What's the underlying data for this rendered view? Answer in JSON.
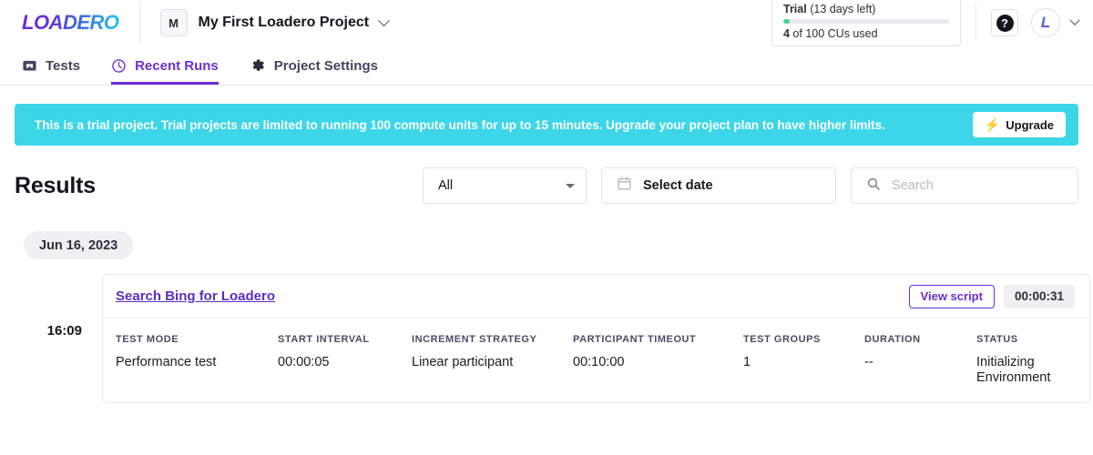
{
  "topbar": {
    "logo_text": "LOADERO",
    "project_initial": "M",
    "project_name": "My First Loadero Project",
    "project_chevron_icon": "chevron-down-icon",
    "trial": {
      "label": "Trial",
      "days_left": "(13 days left)",
      "usage_used": "4",
      "usage_rest": " of 100 CUs used",
      "progress_percent": 4,
      "progress_color": "#3DD68C"
    },
    "help_icon": "question-mark-icon",
    "avatar_letter": "L",
    "avatar_chevron_icon": "chevron-down-icon"
  },
  "tabs": [
    {
      "label": "Tests",
      "icon": "monitor-icon",
      "active": false
    },
    {
      "label": "Recent Runs",
      "icon": "clock-icon",
      "active": true
    },
    {
      "label": "Project Settings",
      "icon": "gear-icon",
      "active": false
    }
  ],
  "banner": {
    "message": "This is a trial project. Trial projects are limited to running 100 compute units for up to 15 minutes. Upgrade your project plan to have higher limits.",
    "button_label": "Upgrade",
    "button_icon": "bolt-icon",
    "background_color": "#3DD6E8"
  },
  "results": {
    "title": "Results",
    "filter_selected": "All",
    "filter_caret_icon": "caret-down-icon",
    "date_label": "Select date",
    "date_icon": "calendar-icon",
    "search_placeholder": "Search",
    "search_value": "",
    "search_icon": "search-icon"
  },
  "run_group": {
    "date_chip": "Jun 16, 2023",
    "run": {
      "time": "16:09",
      "title": "Search Bing for Loadero",
      "view_script_label": "View script",
      "duration_chip": "00:00:31",
      "columns": [
        {
          "header": "TEST MODE",
          "value": "Performance test"
        },
        {
          "header": "START INTERVAL",
          "value": "00:00:05"
        },
        {
          "header": "INCREMENT STRATEGY",
          "value": "Linear participant"
        },
        {
          "header": "PARTICIPANT TIMEOUT",
          "value": "00:10:00"
        },
        {
          "header": "TEST GROUPS",
          "value": "1"
        },
        {
          "header": "DURATION",
          "value": "--"
        },
        {
          "header": "STATUS",
          "value": "Initializing Environment"
        }
      ]
    }
  },
  "theme": {
    "accent_purple": "#6B2FD6",
    "banner_cyan": "#3DD6E8",
    "success_green": "#3DD68C",
    "text_dark": "#15151f"
  }
}
